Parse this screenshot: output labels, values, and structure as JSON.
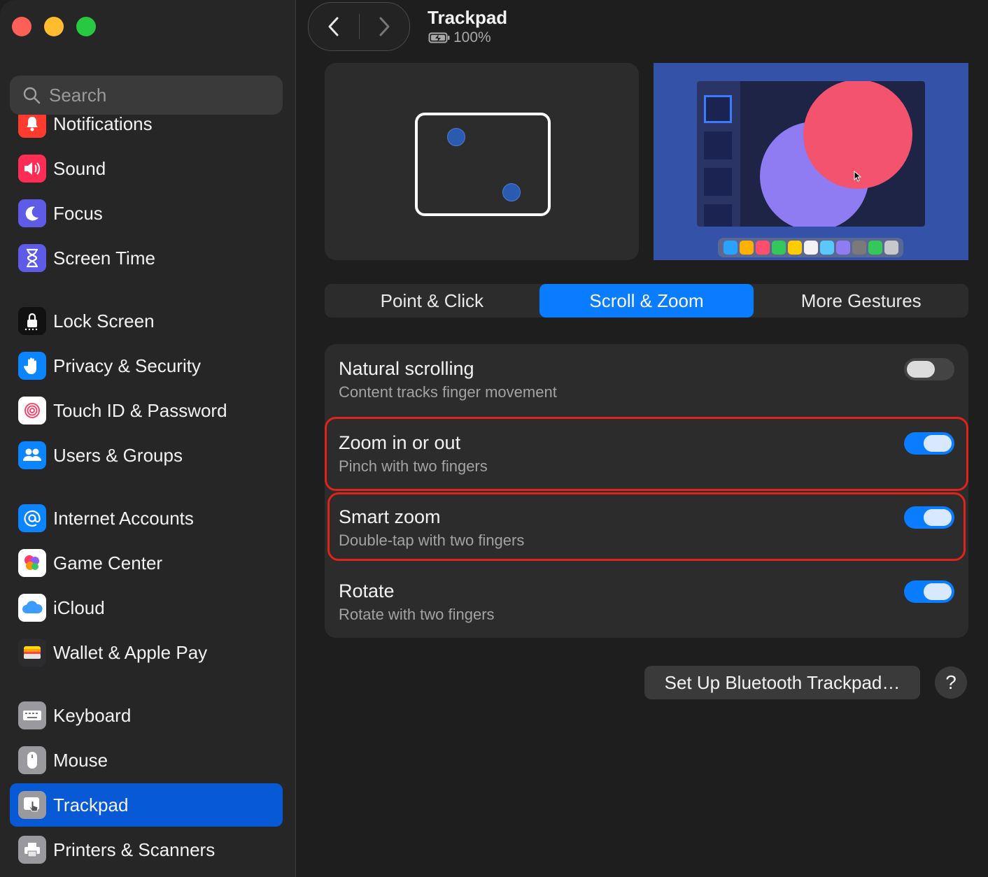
{
  "window": {
    "traffic_lights": [
      "close",
      "minimize",
      "zoom"
    ]
  },
  "search": {
    "placeholder": "Search"
  },
  "sidebar": {
    "items": [
      {
        "label": "Notifications",
        "icon": "bell-icon",
        "color": "#ff3b30"
      },
      {
        "label": "Sound",
        "icon": "speaker-icon",
        "color": "#ff2d55"
      },
      {
        "label": "Focus",
        "icon": "moon-icon",
        "color": "#5e5ce6"
      },
      {
        "label": "Screen Time",
        "icon": "hourglass-icon",
        "color": "#5e5ce6"
      },
      {
        "label": "Lock Screen",
        "icon": "lock-icon",
        "color": "#1c1c1e"
      },
      {
        "label": "Privacy & Security",
        "icon": "hand-icon",
        "color": "#0a84ff"
      },
      {
        "label": "Touch ID & Password",
        "icon": "fingerprint-icon",
        "color": "#ffffff"
      },
      {
        "label": "Users & Groups",
        "icon": "users-icon",
        "color": "#0a84ff"
      },
      {
        "label": "Internet Accounts",
        "icon": "at-icon",
        "color": "#0a84ff"
      },
      {
        "label": "Game Center",
        "icon": "game-center-icon",
        "color": "#ffffff"
      },
      {
        "label": "iCloud",
        "icon": "cloud-icon",
        "color": "#ffffff"
      },
      {
        "label": "Wallet & Apple Pay",
        "icon": "wallet-icon",
        "color": "#2c2c2e"
      },
      {
        "label": "Keyboard",
        "icon": "keyboard-icon",
        "color": "#8e8e93"
      },
      {
        "label": "Mouse",
        "icon": "mouse-icon",
        "color": "#8e8e93"
      },
      {
        "label": "Trackpad",
        "icon": "trackpad-icon",
        "color": "#8e8e93",
        "selected": true
      },
      {
        "label": "Printers & Scanners",
        "icon": "printer-icon",
        "color": "#8e8e93"
      }
    ]
  },
  "header": {
    "title": "Trackpad",
    "battery": "100%",
    "battery_icon": "battery-charging-icon"
  },
  "tabs": [
    {
      "label": "Point & Click",
      "selected": false
    },
    {
      "label": "Scroll & Zoom",
      "selected": true
    },
    {
      "label": "More Gestures",
      "selected": false
    }
  ],
  "settings": [
    {
      "title": "Natural scrolling",
      "subtitle": "Content tracks finger movement",
      "enabled": false
    },
    {
      "title": "Zoom in or out",
      "subtitle": "Pinch with two fingers",
      "enabled": true,
      "highlighted": true
    },
    {
      "title": "Smart zoom",
      "subtitle": "Double-tap with two fingers",
      "enabled": true,
      "highlighted": true
    },
    {
      "title": "Rotate",
      "subtitle": "Rotate with two fingers",
      "enabled": true
    }
  ],
  "buttons": {
    "bluetooth": "Set Up Bluetooth Trackpad…",
    "help": "?"
  },
  "colors": {
    "accent": "#0a7cff",
    "highlight": "#e0231a",
    "selected_sidebar": "#0859d6"
  }
}
